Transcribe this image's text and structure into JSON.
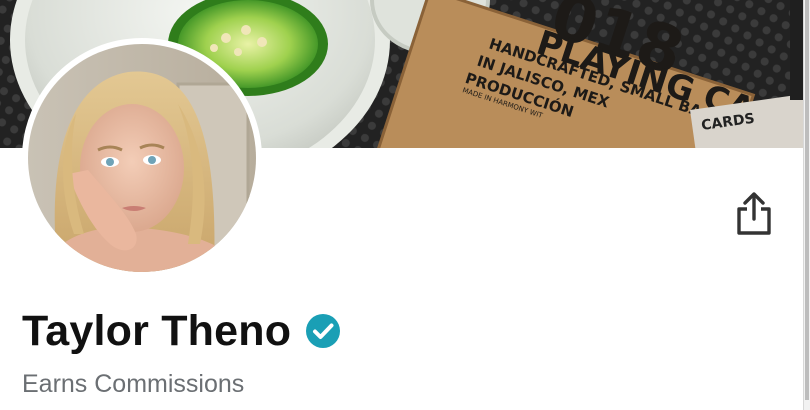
{
  "cover": {
    "background_scene": "jalapeno-drink-and-playing-cards-box",
    "box_big_digits": "018",
    "box_title": "PLAYING CARDS",
    "box_line_1": "HANDCRAFTED, SMALL BA",
    "box_line_2": "IN JALISCO, MEX",
    "box_line_3": "PRODUCCIÓN",
    "box_side_text": "CARDS",
    "box_made_in": "MADE IN HARMONY WIT"
  },
  "profile": {
    "name": "Taylor Theno",
    "verified_icon": "verified-check-icon",
    "subtitle": "Earns Commissions"
  },
  "actions": {
    "share_icon": "share-icon"
  },
  "colors": {
    "verified": "#1a9fb5",
    "name": "#111111",
    "subtitle": "#6b6f73",
    "share_icon": "#333333"
  }
}
